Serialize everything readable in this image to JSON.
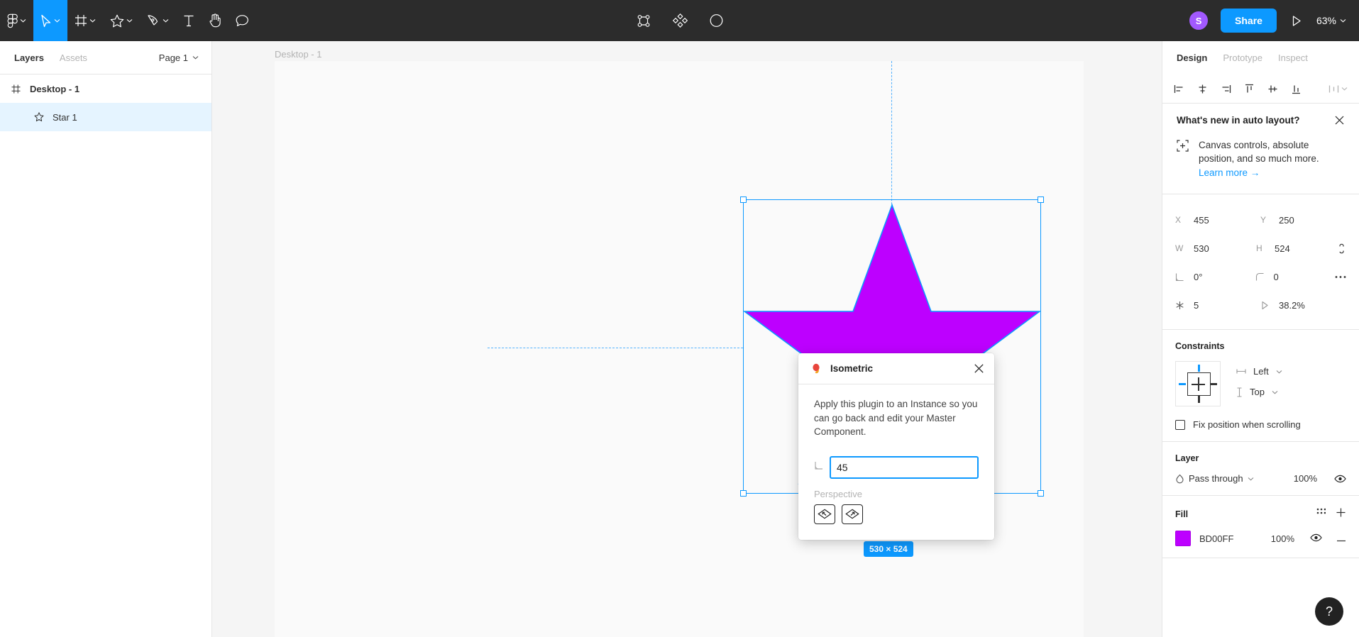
{
  "toolbar": {
    "menu_icon": "figma-logo-icon",
    "tools": [
      {
        "name": "move-tool",
        "icon": "cursor-icon",
        "active": true
      },
      {
        "name": "frame-tool",
        "icon": "frame-icon",
        "active": false
      },
      {
        "name": "shape-tool",
        "icon": "star-icon",
        "active": false
      },
      {
        "name": "pen-tool",
        "icon": "pen-icon",
        "active": false
      },
      {
        "name": "text-tool",
        "icon": "text-icon",
        "active": false
      },
      {
        "name": "hand-tool",
        "icon": "hand-icon",
        "active": false
      },
      {
        "name": "comment-tool",
        "icon": "comment-icon",
        "active": false
      }
    ],
    "center_tools": [
      "component-icon",
      "plugin-diamond-icon",
      "contrast-icon"
    ],
    "avatar_initial": "S",
    "avatar_color": "#a259ff",
    "share_label": "Share",
    "present_icon": "play-icon",
    "zoom_level": "63%",
    "accent_color": "#0d99ff",
    "background": "#2c2c2c"
  },
  "left_panel": {
    "tabs": [
      {
        "label": "Layers",
        "active": true
      },
      {
        "label": "Assets",
        "active": false
      }
    ],
    "page_selector": "Page 1",
    "layers": [
      {
        "name": "Desktop - 1",
        "icon": "frame-icon",
        "type": "frame",
        "selected": false
      },
      {
        "name": "Star 1",
        "icon": "star-icon",
        "type": "star",
        "selected": true
      }
    ]
  },
  "canvas": {
    "frame_label": "Desktop - 1",
    "dimension_badge": "530 × 524",
    "star_fill": "#BD00FF",
    "selection_color": "#0d99ff",
    "background": "#f5f5f5",
    "frame_background": "#fafafa"
  },
  "plugin": {
    "title": "Isometric",
    "icon": "plugin-balloon-icon",
    "close_icon": "close-icon",
    "description": "Apply this plugin to an Instance so you can go back and edit your Master Component.",
    "angle_icon": "angle-icon",
    "angle_value": "45",
    "perspective_label": "Perspective",
    "perspective_buttons": [
      {
        "name": "perspective-left-button",
        "icon": "diamond-arrow-up-left-icon"
      },
      {
        "name": "perspective-right-button",
        "icon": "diamond-arrow-up-right-icon"
      }
    ]
  },
  "right_panel": {
    "tabs": [
      {
        "label": "Design",
        "active": true
      },
      {
        "label": "Prototype",
        "active": false
      },
      {
        "label": "Inspect",
        "active": false
      }
    ],
    "align_buttons": [
      "align-left-icon",
      "align-horizontal-center-icon",
      "align-right-icon",
      "align-top-icon",
      "align-vertical-center-icon",
      "align-bottom-icon",
      "distribute-icon"
    ],
    "whats_new": {
      "title": "What's new in auto layout?",
      "close_icon": "close-icon",
      "icon": "canvas-controls-icon",
      "body": "Canvas controls, absolute position, and so much more.",
      "link": "Learn more →"
    },
    "properties": {
      "x_label": "X",
      "x_value": "455",
      "y_label": "Y",
      "y_value": "250",
      "w_label": "W",
      "w_value": "530",
      "h_label": "H",
      "h_value": "524",
      "rotation_icon": "angle-icon",
      "rotation_value": "0°",
      "corner_icon": "corner-radius-icon",
      "corner_value": "0",
      "points_icon": "star-points-icon",
      "points_value": "5",
      "ratio_icon": "star-ratio-icon",
      "ratio_value": "38.2%",
      "constrain_icon": "constrain-proportions-icon",
      "more_icon": "more-options-icon"
    },
    "constraints": {
      "title": "Constraints",
      "horizontal_icon": "horizontal-constraint-icon",
      "horizontal_value": "Left",
      "vertical_icon": "vertical-constraint-icon",
      "vertical_value": "Top",
      "fix_position_label": "Fix position when scrolling",
      "fix_position_checked": false
    },
    "layer": {
      "title": "Layer",
      "blend_icon": "blend-mode-icon",
      "blend_mode": "Pass through",
      "opacity": "100%",
      "visibility_icon": "eye-icon"
    },
    "fill": {
      "title": "Fill",
      "styles_icon": "styles-grid-icon",
      "add_icon": "plus-icon",
      "color_hex": "BD00FF",
      "color_value": "#BD00FF",
      "opacity": "100%",
      "visibility_icon": "eye-icon",
      "remove_icon": "minus-icon"
    },
    "help_button": "?"
  }
}
